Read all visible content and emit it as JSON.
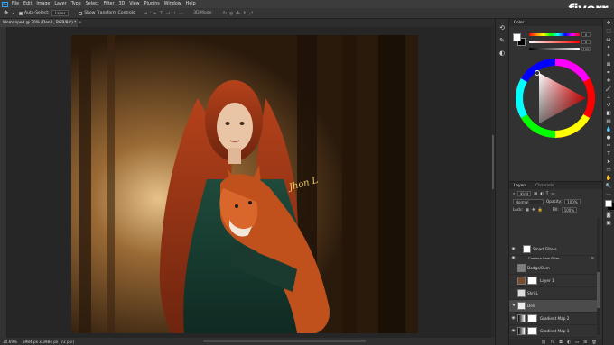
{
  "menu": {
    "app_icon": "Ps",
    "items": [
      "File",
      "Edit",
      "Image",
      "Layer",
      "Type",
      "Select",
      "Filter",
      "3D",
      "View",
      "Plugins",
      "Window",
      "Help"
    ],
    "window_controls": [
      "—",
      "☐",
      "✕"
    ]
  },
  "watermark": {
    "brand": "fiverr",
    "dot": "."
  },
  "options": {
    "auto_select_label": "Auto-Select:",
    "auto_select_target": "Layer",
    "transform_controls_label": "Show Transform Controls",
    "mode_3d_label": "3D Mode:"
  },
  "document": {
    "tab_title": "Womanped @ 30% (Den L, RGB/8#) *",
    "close": "×"
  },
  "status": {
    "zoom": "30.69%",
    "doc_size": "3984 px x 3984 px (72 ppi)"
  },
  "color_panel": {
    "tabs": [
      "Color"
    ],
    "slider_values": [
      "0",
      "0",
      "100"
    ],
    "colors": {
      "foreground": "#ffffff",
      "background": "#000000",
      "wheel_hue": "#ff0000"
    }
  },
  "layers_panel": {
    "tabs": [
      "Layers",
      "Channels"
    ],
    "filter_label": "Kind",
    "blend_mode": "Normal",
    "opacity_label": "Opacity:",
    "opacity_value": "100%",
    "lock_label": "Lock:",
    "fill_label": "Fill:",
    "fill_value": "100%",
    "layers": [
      {
        "name": "Smart Filters",
        "type": "smart-filters"
      },
      {
        "name": "Camera Raw Filter",
        "type": "filter"
      },
      {
        "name": "Dodge/Burn",
        "type": "layer"
      },
      {
        "name": "Layer 1",
        "type": "layer"
      },
      {
        "name": "Shri L",
        "type": "layer"
      },
      {
        "name": "Den",
        "type": "layer",
        "selected": true
      },
      {
        "name": "Gradient Map 2",
        "type": "adjustment"
      },
      {
        "name": "Gradient Map 1",
        "type": "adjustment"
      },
      {
        "name": "Color Lookup 1",
        "type": "adjustment"
      },
      {
        "name": "Color Lookup 2",
        "type": "adjustment"
      }
    ],
    "footer_icons": [
      "link-icon",
      "fx-icon",
      "mask-icon",
      "adjustment-icon",
      "folder-icon",
      "new-layer-icon",
      "trash-icon"
    ]
  },
  "artwork": {
    "signature_text": "Jhon L"
  }
}
